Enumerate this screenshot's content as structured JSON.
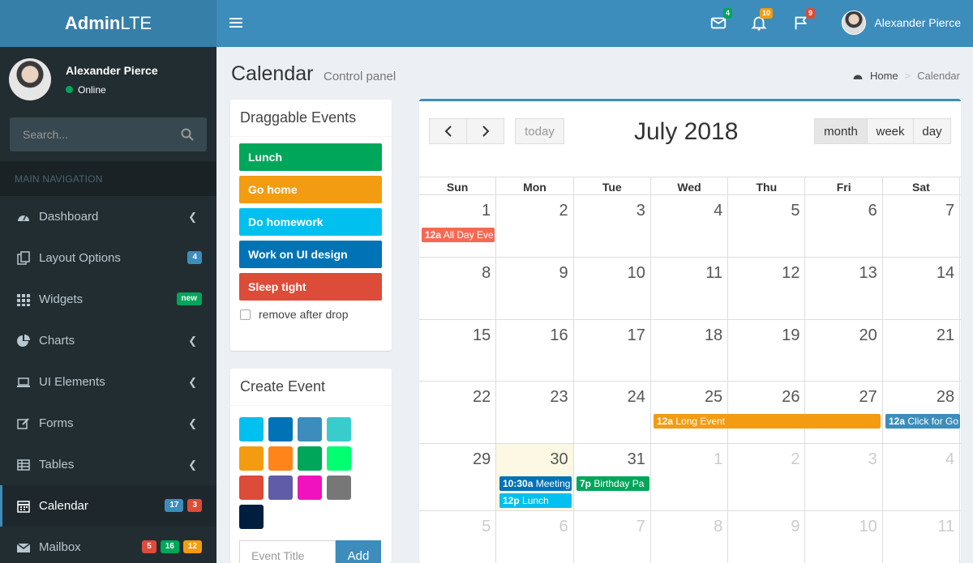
{
  "header": {
    "logo_bold": "Admin",
    "logo_light": "LTE",
    "mail_count": "4",
    "notif_count": "10",
    "flag_count": "9",
    "user_name": "Alexander Pierce"
  },
  "sidebar": {
    "user_name": "Alexander Pierce",
    "status": "Online",
    "search_placeholder": "Search...",
    "nav_header": "MAIN NAVIGATION",
    "items": [
      {
        "label": "Dashboard"
      },
      {
        "label": "Layout Options",
        "badge": "4"
      },
      {
        "label": "Widgets",
        "badge": "new"
      },
      {
        "label": "Charts"
      },
      {
        "label": "UI Elements"
      },
      {
        "label": "Forms"
      },
      {
        "label": "Tables"
      },
      {
        "label": "Calendar",
        "badges": [
          "17",
          "3"
        ]
      },
      {
        "label": "Mailbox",
        "badges": [
          "5",
          "16",
          "12"
        ]
      }
    ]
  },
  "page": {
    "title": "Calendar",
    "subtitle": "Control panel",
    "breadcrumb_home": "Home",
    "breadcrumb_current": "Calendar"
  },
  "draggable": {
    "title": "Draggable Events",
    "events": [
      {
        "label": "Lunch",
        "color": "#00a65a"
      },
      {
        "label": "Go home",
        "color": "#f39c12"
      },
      {
        "label": "Do homework",
        "color": "#00c0ef"
      },
      {
        "label": "Work on UI design",
        "color": "#0073b7"
      },
      {
        "label": "Sleep tight",
        "color": "#dd4b39"
      }
    ],
    "remove_label": "remove after drop"
  },
  "create_event": {
    "title": "Create Event",
    "colors": [
      "#00c0ef",
      "#0073b7",
      "#3c8dbc",
      "#39cccc",
      "#f39c12",
      "#ff851b",
      "#00a65a",
      "#01ff70",
      "#dd4b39",
      "#605ca8",
      "#f012be",
      "#777777",
      "#001f3f"
    ],
    "input_placeholder": "Event Title",
    "add_label": "Add"
  },
  "calendar": {
    "title": "July 2018",
    "today_label": "today",
    "views": [
      "month",
      "week",
      "day"
    ],
    "dow": [
      "Sun",
      "Mon",
      "Tue",
      "Wed",
      "Thu",
      "Fri",
      "Sat"
    ],
    "weeks": [
      [
        "1",
        "2",
        "3",
        "4",
        "5",
        "6",
        "7"
      ],
      [
        "8",
        "9",
        "10",
        "11",
        "12",
        "13",
        "14"
      ],
      [
        "15",
        "16",
        "17",
        "18",
        "19",
        "20",
        "21"
      ],
      [
        "22",
        "23",
        "24",
        "25",
        "26",
        "27",
        "28"
      ],
      [
        "29",
        "30",
        "31",
        "1",
        "2",
        "3",
        "4"
      ],
      [
        "5",
        "6",
        "7",
        "8",
        "9",
        "10",
        "11"
      ]
    ],
    "events": {
      "all_day_time": "12a",
      "all_day_title": "All Day Eve",
      "long_time": "12a",
      "long_title": "Long Event",
      "click_time": "12a",
      "click_title": "Click for Go",
      "meeting_time": "10:30a",
      "meeting_title": "Meeting",
      "birthday_time": "7p",
      "birthday_title": "Birthday Pa",
      "lunch_time": "12p",
      "lunch_title": "Lunch"
    }
  }
}
